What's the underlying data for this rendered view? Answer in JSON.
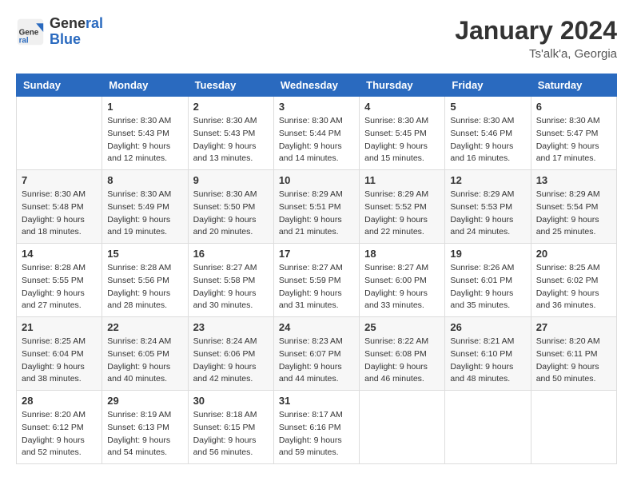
{
  "header": {
    "logo_general": "General",
    "logo_blue": "Blue",
    "month_title": "January 2024",
    "subtitle": "Ts'alk'a, Georgia"
  },
  "weekdays": [
    "Sunday",
    "Monday",
    "Tuesday",
    "Wednesday",
    "Thursday",
    "Friday",
    "Saturday"
  ],
  "weeks": [
    [
      {
        "day": "",
        "info": ""
      },
      {
        "day": "1",
        "info": "Sunrise: 8:30 AM\nSunset: 5:43 PM\nDaylight: 9 hours\nand 12 minutes."
      },
      {
        "day": "2",
        "info": "Sunrise: 8:30 AM\nSunset: 5:43 PM\nDaylight: 9 hours\nand 13 minutes."
      },
      {
        "day": "3",
        "info": "Sunrise: 8:30 AM\nSunset: 5:44 PM\nDaylight: 9 hours\nand 14 minutes."
      },
      {
        "day": "4",
        "info": "Sunrise: 8:30 AM\nSunset: 5:45 PM\nDaylight: 9 hours\nand 15 minutes."
      },
      {
        "day": "5",
        "info": "Sunrise: 8:30 AM\nSunset: 5:46 PM\nDaylight: 9 hours\nand 16 minutes."
      },
      {
        "day": "6",
        "info": "Sunrise: 8:30 AM\nSunset: 5:47 PM\nDaylight: 9 hours\nand 17 minutes."
      }
    ],
    [
      {
        "day": "7",
        "info": "Sunrise: 8:30 AM\nSunset: 5:48 PM\nDaylight: 9 hours\nand 18 minutes."
      },
      {
        "day": "8",
        "info": "Sunrise: 8:30 AM\nSunset: 5:49 PM\nDaylight: 9 hours\nand 19 minutes."
      },
      {
        "day": "9",
        "info": "Sunrise: 8:30 AM\nSunset: 5:50 PM\nDaylight: 9 hours\nand 20 minutes."
      },
      {
        "day": "10",
        "info": "Sunrise: 8:29 AM\nSunset: 5:51 PM\nDaylight: 9 hours\nand 21 minutes."
      },
      {
        "day": "11",
        "info": "Sunrise: 8:29 AM\nSunset: 5:52 PM\nDaylight: 9 hours\nand 22 minutes."
      },
      {
        "day": "12",
        "info": "Sunrise: 8:29 AM\nSunset: 5:53 PM\nDaylight: 9 hours\nand 24 minutes."
      },
      {
        "day": "13",
        "info": "Sunrise: 8:29 AM\nSunset: 5:54 PM\nDaylight: 9 hours\nand 25 minutes."
      }
    ],
    [
      {
        "day": "14",
        "info": "Sunrise: 8:28 AM\nSunset: 5:55 PM\nDaylight: 9 hours\nand 27 minutes."
      },
      {
        "day": "15",
        "info": "Sunrise: 8:28 AM\nSunset: 5:56 PM\nDaylight: 9 hours\nand 28 minutes."
      },
      {
        "day": "16",
        "info": "Sunrise: 8:27 AM\nSunset: 5:58 PM\nDaylight: 9 hours\nand 30 minutes."
      },
      {
        "day": "17",
        "info": "Sunrise: 8:27 AM\nSunset: 5:59 PM\nDaylight: 9 hours\nand 31 minutes."
      },
      {
        "day": "18",
        "info": "Sunrise: 8:27 AM\nSunset: 6:00 PM\nDaylight: 9 hours\nand 33 minutes."
      },
      {
        "day": "19",
        "info": "Sunrise: 8:26 AM\nSunset: 6:01 PM\nDaylight: 9 hours\nand 35 minutes."
      },
      {
        "day": "20",
        "info": "Sunrise: 8:25 AM\nSunset: 6:02 PM\nDaylight: 9 hours\nand 36 minutes."
      }
    ],
    [
      {
        "day": "21",
        "info": "Sunrise: 8:25 AM\nSunset: 6:04 PM\nDaylight: 9 hours\nand 38 minutes."
      },
      {
        "day": "22",
        "info": "Sunrise: 8:24 AM\nSunset: 6:05 PM\nDaylight: 9 hours\nand 40 minutes."
      },
      {
        "day": "23",
        "info": "Sunrise: 8:24 AM\nSunset: 6:06 PM\nDaylight: 9 hours\nand 42 minutes."
      },
      {
        "day": "24",
        "info": "Sunrise: 8:23 AM\nSunset: 6:07 PM\nDaylight: 9 hours\nand 44 minutes."
      },
      {
        "day": "25",
        "info": "Sunrise: 8:22 AM\nSunset: 6:08 PM\nDaylight: 9 hours\nand 46 minutes."
      },
      {
        "day": "26",
        "info": "Sunrise: 8:21 AM\nSunset: 6:10 PM\nDaylight: 9 hours\nand 48 minutes."
      },
      {
        "day": "27",
        "info": "Sunrise: 8:20 AM\nSunset: 6:11 PM\nDaylight: 9 hours\nand 50 minutes."
      }
    ],
    [
      {
        "day": "28",
        "info": "Sunrise: 8:20 AM\nSunset: 6:12 PM\nDaylight: 9 hours\nand 52 minutes."
      },
      {
        "day": "29",
        "info": "Sunrise: 8:19 AM\nSunset: 6:13 PM\nDaylight: 9 hours\nand 54 minutes."
      },
      {
        "day": "30",
        "info": "Sunrise: 8:18 AM\nSunset: 6:15 PM\nDaylight: 9 hours\nand 56 minutes."
      },
      {
        "day": "31",
        "info": "Sunrise: 8:17 AM\nSunset: 6:16 PM\nDaylight: 9 hours\nand 59 minutes."
      },
      {
        "day": "",
        "info": ""
      },
      {
        "day": "",
        "info": ""
      },
      {
        "day": "",
        "info": ""
      }
    ]
  ]
}
